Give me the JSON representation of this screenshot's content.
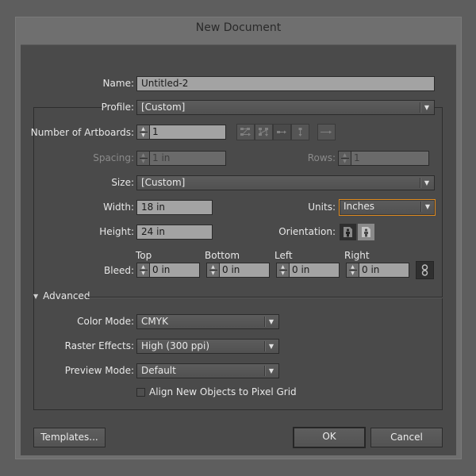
{
  "window": {
    "title": "New Document"
  },
  "name": {
    "label": "Name:",
    "value": "Untitled-2"
  },
  "profile": {
    "label": "Profile:",
    "value": "[Custom]"
  },
  "artboards": {
    "label": "Number of Artboards:",
    "value": "1",
    "arrange_icons": [
      "grid-by-row-icon",
      "grid-by-column-icon",
      "arrange-by-row-icon",
      "arrange-by-column-icon"
    ],
    "direction_icon": "right-to-left-layout-icon"
  },
  "spacing": {
    "label": "Spacing:",
    "value": "1 in",
    "disabled": true
  },
  "rows": {
    "label": "Rows:",
    "value": "1",
    "disabled": true
  },
  "size": {
    "label": "Size:",
    "value": "[Custom]"
  },
  "width": {
    "label": "Width:",
    "value": "18 in"
  },
  "units": {
    "label": "Units:",
    "value": "Inches"
  },
  "height": {
    "label": "Height:",
    "value": "24 in"
  },
  "orientation": {
    "label": "Orientation:",
    "selected": "portrait",
    "options": [
      "portrait",
      "landscape"
    ]
  },
  "bleed": {
    "label": "Bleed:",
    "top": {
      "label": "Top",
      "value": "0 in"
    },
    "bottom": {
      "label": "Bottom",
      "value": "0 in"
    },
    "left": {
      "label": "Left",
      "value": "0 in"
    },
    "right": {
      "label": "Right",
      "value": "0 in"
    },
    "linked": true
  },
  "advanced": {
    "label": "Advanced",
    "expanded": true,
    "color_mode": {
      "label": "Color Mode:",
      "value": "CMYK"
    },
    "raster_effects": {
      "label": "Raster Effects:",
      "value": "High (300 ppi)"
    },
    "preview_mode": {
      "label": "Preview Mode:",
      "value": "Default"
    },
    "pixel_grid": {
      "label": "Align New Objects to Pixel Grid",
      "checked": false
    }
  },
  "buttons": {
    "templates": "Templates...",
    "ok": "OK",
    "cancel": "Cancel"
  },
  "colors": {
    "focus_accent": "#e08a1e",
    "dialog_bg": "#4a4a4a",
    "field_bg": "#a3a3a3"
  }
}
